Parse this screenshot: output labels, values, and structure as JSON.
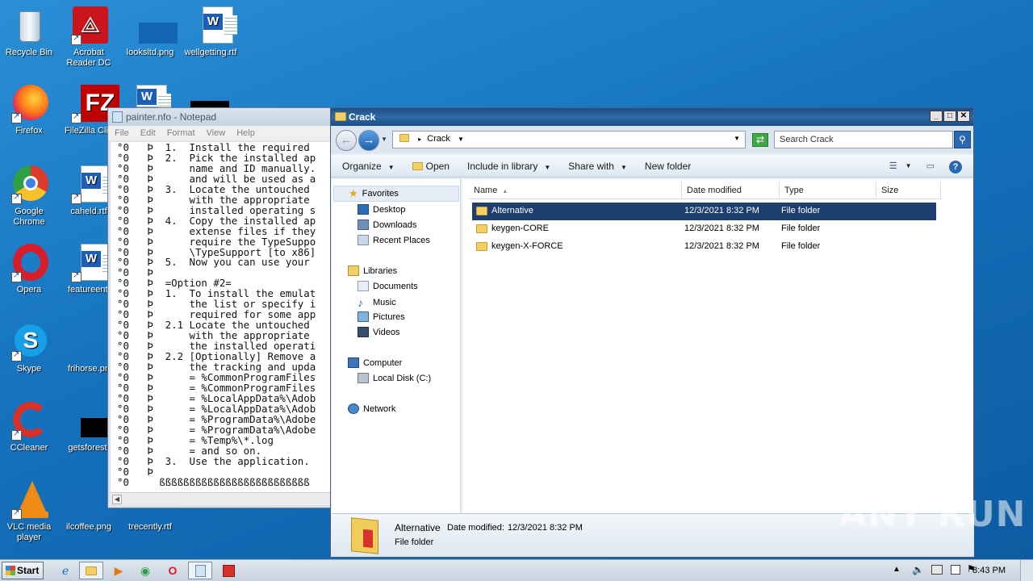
{
  "desktop": {
    "icons": [
      {
        "label": "Recycle Bin",
        "icon": "recycle-bin-icon"
      },
      {
        "label": "Acrobat Reader DC",
        "icon": "acrobat-icon"
      },
      {
        "label": "looksltd.png",
        "icon": "image-file-icon"
      },
      {
        "label": "wellgetting.rtf",
        "icon": "word-doc-icon"
      },
      {
        "label": "Firefox",
        "icon": "firefox-icon"
      },
      {
        "label": "FileZilla Clie",
        "icon": "filezilla-icon"
      },
      {
        "label": "Google Chrome",
        "icon": "chrome-icon"
      },
      {
        "label": "caheld.rtf",
        "icon": "word-doc-icon"
      },
      {
        "label": "Opera",
        "icon": "opera-icon"
      },
      {
        "label": "featureenti",
        "icon": "word-doc-icon"
      },
      {
        "label": "Skype",
        "icon": "skype-icon"
      },
      {
        "label": "frihorse.pn",
        "icon": "image-file-icon"
      },
      {
        "label": "CCleaner",
        "icon": "ccleaner-icon"
      },
      {
        "label": "getsforest.",
        "icon": "image-file-icon"
      },
      {
        "label": "VLC media player",
        "icon": "vlc-icon"
      },
      {
        "label": "ilcoffee.png",
        "icon": "image-file-icon"
      },
      {
        "label": "trecently.rtf",
        "icon": "word-doc-icon"
      }
    ]
  },
  "notepad": {
    "title": "painter.nfo - Notepad",
    "menu": [
      "File",
      "Edit",
      "Format",
      "View",
      "Help"
    ],
    "lines": [
      "°0   Þ  1.  Install the required",
      "°0   Þ  2.  Pick the installed ap",
      "°0   Þ      name and ID manually.",
      "°0   Þ      and will be used as a",
      "°0   Þ  3.  Locate the untouched",
      "°0   Þ      with the appropriate",
      "°0   Þ      installed operating s",
      "°0   Þ  4.  Copy the installed ap",
      "°0   Þ      extense files if they",
      "°0   Þ      require the TypeSuppo",
      "°0   Þ      \\TypeSupport [to x86]",
      "°0   Þ  5.  Now you can use your",
      "°0   Þ",
      "°0   Þ  =Option #2=",
      "°0   Þ  1.  To install the emulat",
      "°0   Þ      the list or specify i",
      "°0   Þ      required for some app",
      "°0   Þ  2.1 Locate the untouched",
      "°0   Þ      with the appropriate",
      "°0   Þ      the installed operati",
      "°0   Þ  2.2 [Optionally] Remove a",
      "°0   Þ      the tracking and upda",
      "°0   Þ      = %CommonProgramFiles",
      "°0   Þ      = %CommonProgramFiles",
      "°0   Þ      = %LocalAppData%\\Adob",
      "°0   Þ      = %LocalAppData%\\Adob",
      "°0   Þ      = %ProgramData%\\Adobe",
      "°0   Þ      = %ProgramData%\\Adobe",
      "°0   Þ      = %Temp%\\*.log",
      "°0   Þ      = and so on.",
      "°0   Þ  3.  Use the application.",
      "°0   Þ",
      "°0     ßßßßßßßßßßßßßßßßßßßßßßßßß"
    ]
  },
  "explorer": {
    "title": "Crack",
    "address_path": "Crack",
    "search_placeholder": "Search Crack",
    "toolbar": {
      "organize": "Organize",
      "open": "Open",
      "include_in_library": "Include in library",
      "share_with": "Share with",
      "new_folder": "New folder"
    },
    "nav": {
      "favorites": "Favorites",
      "desktop": "Desktop",
      "downloads": "Downloads",
      "recent_places": "Recent Places",
      "libraries": "Libraries",
      "documents": "Documents",
      "music": "Music",
      "pictures": "Pictures",
      "videos": "Videos",
      "computer": "Computer",
      "local_disk": "Local Disk (C:)",
      "network": "Network"
    },
    "columns": {
      "name": "Name",
      "date_modified": "Date modified",
      "type": "Type",
      "size": "Size"
    },
    "files": [
      {
        "name": "Alternative",
        "date": "12/3/2021 8:32 PM",
        "type": "File folder",
        "size": ""
      },
      {
        "name": "keygen-CORE",
        "date": "12/3/2021 8:32 PM",
        "type": "File folder",
        "size": ""
      },
      {
        "name": "keygen-X-FORCE",
        "date": "12/3/2021 8:32 PM",
        "type": "File folder",
        "size": ""
      }
    ],
    "details": {
      "name": "Alternative",
      "date_label": "Date modified:",
      "date_value": "12/3/2021 8:32 PM",
      "type": "File folder"
    }
  },
  "taskbar": {
    "start_label": "Start",
    "clock": "8:43 PM"
  },
  "watermark": "ANY RUN"
}
